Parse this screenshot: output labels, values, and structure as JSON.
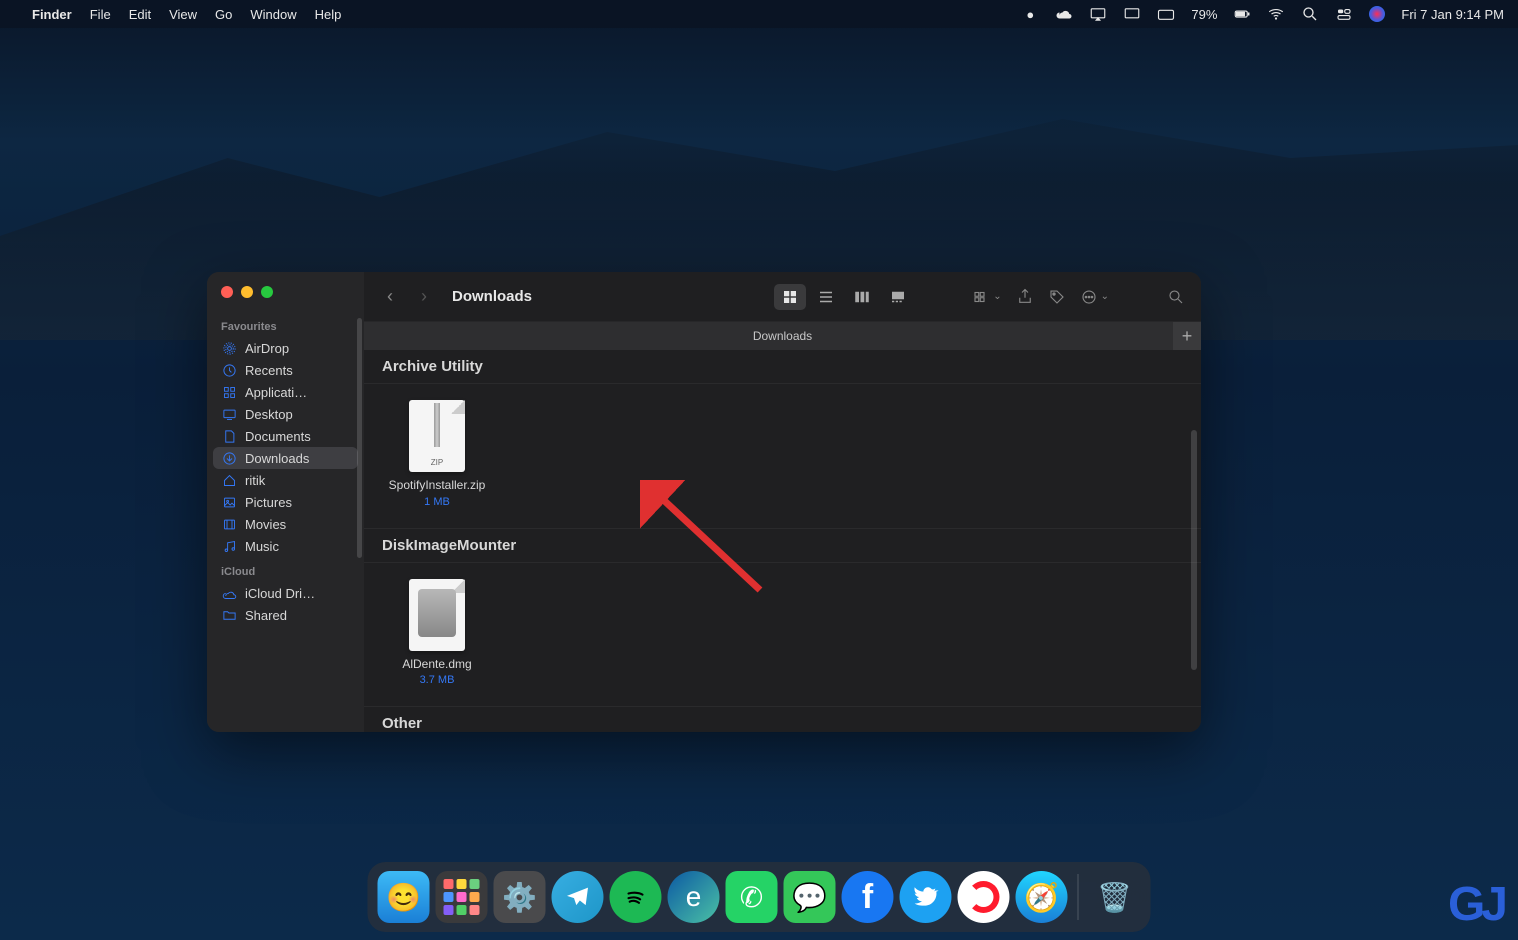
{
  "menubar": {
    "app": "Finder",
    "items": [
      "File",
      "Edit",
      "View",
      "Go",
      "Window",
      "Help"
    ],
    "battery": "79%",
    "datetime": "Fri 7 Jan  9:14 PM"
  },
  "finder": {
    "title": "Downloads",
    "pathbar": "Downloads",
    "sidebar": {
      "sections": [
        {
          "label": "Favourites",
          "items": [
            {
              "icon": "airdrop",
              "label": "AirDrop"
            },
            {
              "icon": "clock",
              "label": "Recents"
            },
            {
              "icon": "grid",
              "label": "Applicati…"
            },
            {
              "icon": "desktop",
              "label": "Desktop"
            },
            {
              "icon": "doc",
              "label": "Documents"
            },
            {
              "icon": "download",
              "label": "Downloads",
              "active": true
            },
            {
              "icon": "house",
              "label": "ritik"
            },
            {
              "icon": "image",
              "label": "Pictures"
            },
            {
              "icon": "film",
              "label": "Movies"
            },
            {
              "icon": "music",
              "label": "Music"
            }
          ]
        },
        {
          "label": "iCloud",
          "items": [
            {
              "icon": "cloud",
              "label": "iCloud Dri…"
            },
            {
              "icon": "folder",
              "label": "Shared"
            }
          ]
        }
      ]
    },
    "groups": [
      {
        "name": "Archive Utility",
        "files": [
          {
            "name": "SpotifyInstaller.zip",
            "size": "1 MB",
            "type": "zip"
          }
        ]
      },
      {
        "name": "DiskImageMounter",
        "files": [
          {
            "name": "AlDente.dmg",
            "size": "3.7 MB",
            "type": "dmg"
          }
        ]
      },
      {
        "name": "Other",
        "files": []
      }
    ]
  },
  "dock": {
    "apps": [
      "finder",
      "launchpad",
      "settings",
      "telegram",
      "spotify",
      "edge",
      "whatsapp",
      "messages",
      "facebook",
      "twitter",
      "opera",
      "safari"
    ]
  },
  "watermark": "GJ"
}
